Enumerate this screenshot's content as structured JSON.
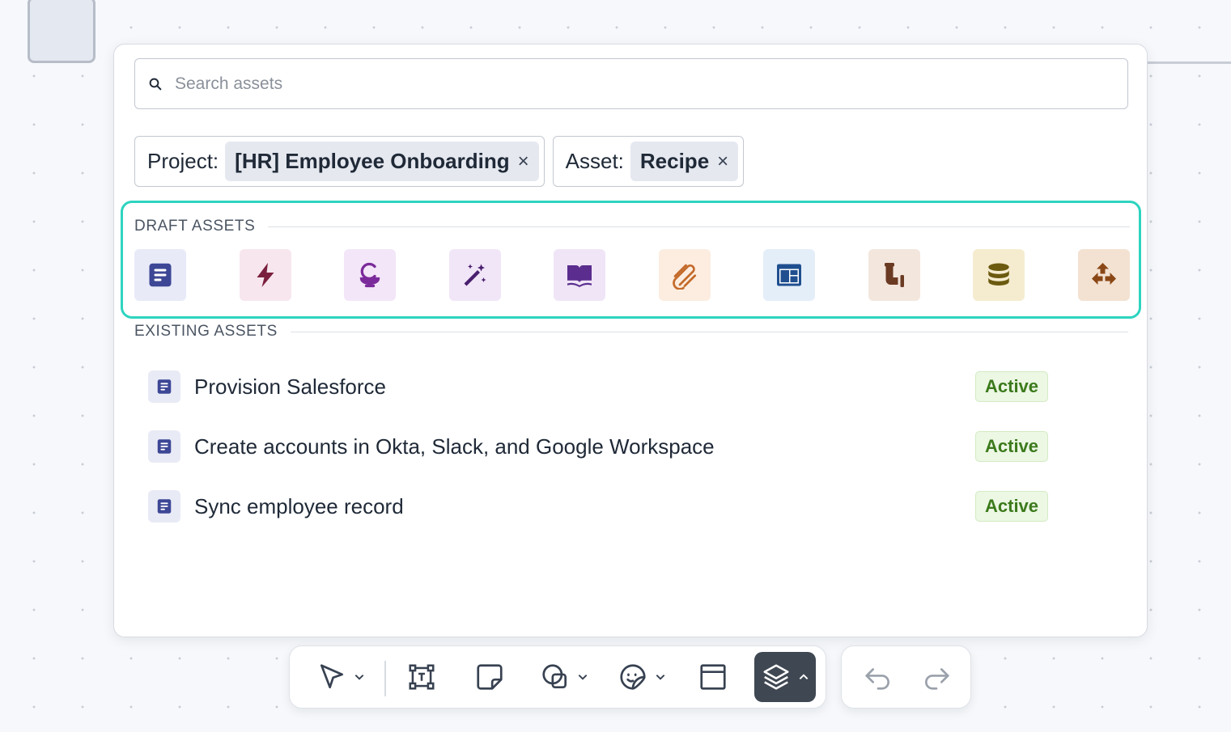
{
  "search": {
    "placeholder": "Search assets",
    "value": ""
  },
  "filters": [
    {
      "key": "Project:",
      "value": "[HR] Employee Onboarding"
    },
    {
      "key": "Asset:",
      "value": "Recipe"
    }
  ],
  "draft_assets": {
    "title": "DRAFT ASSETS",
    "tiles": [
      {
        "icon": "recipe-icon",
        "bg": "#e8eaf8",
        "fg": "#3d4796"
      },
      {
        "icon": "lightning-icon",
        "bg": "#f7e6ee",
        "fg": "#7a1f3d"
      },
      {
        "icon": "genie-lamp-icon",
        "bg": "#f3e6f8",
        "fg": "#7b2a9b"
      },
      {
        "icon": "magic-wand-icon",
        "bg": "#f1e6f8",
        "fg": "#4a1f6e"
      },
      {
        "icon": "book-icon",
        "bg": "#efe5f7",
        "fg": "#5b2d8e"
      },
      {
        "icon": "connector-icon",
        "bg": "#fcede0",
        "fg": "#c46a2a"
      },
      {
        "icon": "page-layout-icon",
        "bg": "#e4eef9",
        "fg": "#1f4f8f"
      },
      {
        "icon": "pipe-icon",
        "bg": "#f3e6dd",
        "fg": "#6b3a22"
      },
      {
        "icon": "database-icon",
        "bg": "#f5ecd0",
        "fg": "#6b5a0f"
      },
      {
        "icon": "workflow-arrows-icon",
        "bg": "#f3e2d2",
        "fg": "#8a4716"
      }
    ]
  },
  "existing_assets": {
    "title": "EXISTING ASSETS",
    "rows": [
      {
        "name": "Provision Salesforce",
        "status": "Active",
        "icon": "recipe-icon"
      },
      {
        "name": "Create accounts in Okta, Slack, and Google Workspace",
        "status": "Active",
        "icon": "recipe-icon"
      },
      {
        "name": "Sync employee record",
        "status": "Active",
        "icon": "recipe-icon"
      }
    ]
  },
  "colors": {
    "accent_outline": "#2dd4bf",
    "status_active_text": "#3c7a1c",
    "status_active_bg": "#ecf7e4",
    "toolbar_active_bg": "#3f4752"
  },
  "toolbar": {
    "tools": [
      "select-tool",
      "text-frame-tool",
      "sticky-note-tool",
      "shapes-tool",
      "sticker-tool",
      "frame-tool",
      "assets-tool"
    ],
    "active_tool": "assets-tool",
    "history": [
      "undo",
      "redo"
    ]
  }
}
